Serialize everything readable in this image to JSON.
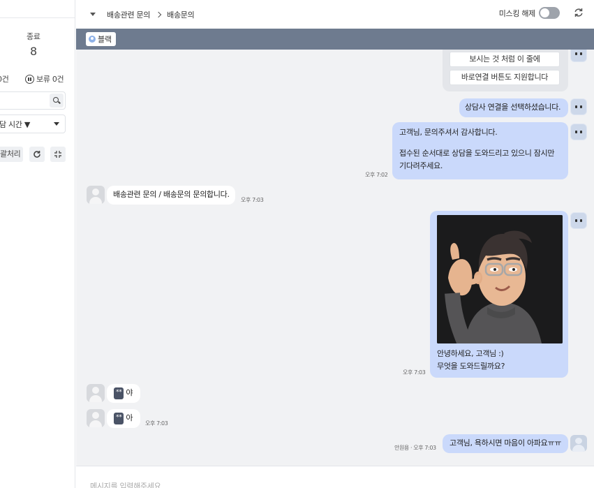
{
  "sidebar": {
    "stat_label": "종료",
    "stat_value": "8",
    "count_partial": "0건",
    "hold_label": "보류 0건",
    "sort_label": "담 시간 ▼",
    "bulk_label": "괄처리"
  },
  "header": {
    "breadcrumb_1": "배송관련 문의",
    "breadcrumb_2": "배송문의",
    "masking_label": "미스킹 해제",
    "masking_on": false
  },
  "tag_bar": {
    "tag": "블랙"
  },
  "messages": {
    "option_1": "보시는 것 처럼 이 줄에",
    "option_2": "바로연결 버튼도 지원합니다",
    "bot_1": "상담사 연결을 선택하셨습니다.",
    "bot_2_line1": "고객님, 문의주셔서 감사합니다.",
    "bot_2_line2": "접수된 순서대로 상담을 도와드리고 있으니 잠시만",
    "bot_2_line3": "기다려주세요.",
    "bot_2_time": "오후 7:02",
    "user_1": "배송관련 문의 / 배송문의 문의합니다.",
    "user_1_time": "오후 7:03",
    "bot_3_line1": "안녕하세요, 고객님 :)",
    "bot_3_line2": "무엇을 도와드릴까요?",
    "bot_3_time": "오후 7:03",
    "user_2_mask": "**",
    "user_2_text": "야",
    "user_3_mask": "**",
    "user_3_text": "아",
    "user_3_time": "오후 7:03",
    "agent_1": "고객님, 욕하시면 마음이 아파요ㅠㅠ",
    "agent_1_meta": "안원용 · 오후 7:03"
  },
  "input": {
    "placeholder": "메시지를 입력해주세요"
  },
  "colors": {
    "bubble_bot": "#cad9fb",
    "tag_bar": "#6e7b8f",
    "chat_bg": "#f1f2f4"
  },
  "icons": [
    "search-icon",
    "pause-icon",
    "refresh-icon",
    "collapse-icon",
    "chevron-right-icon",
    "caret-down-icon"
  ]
}
